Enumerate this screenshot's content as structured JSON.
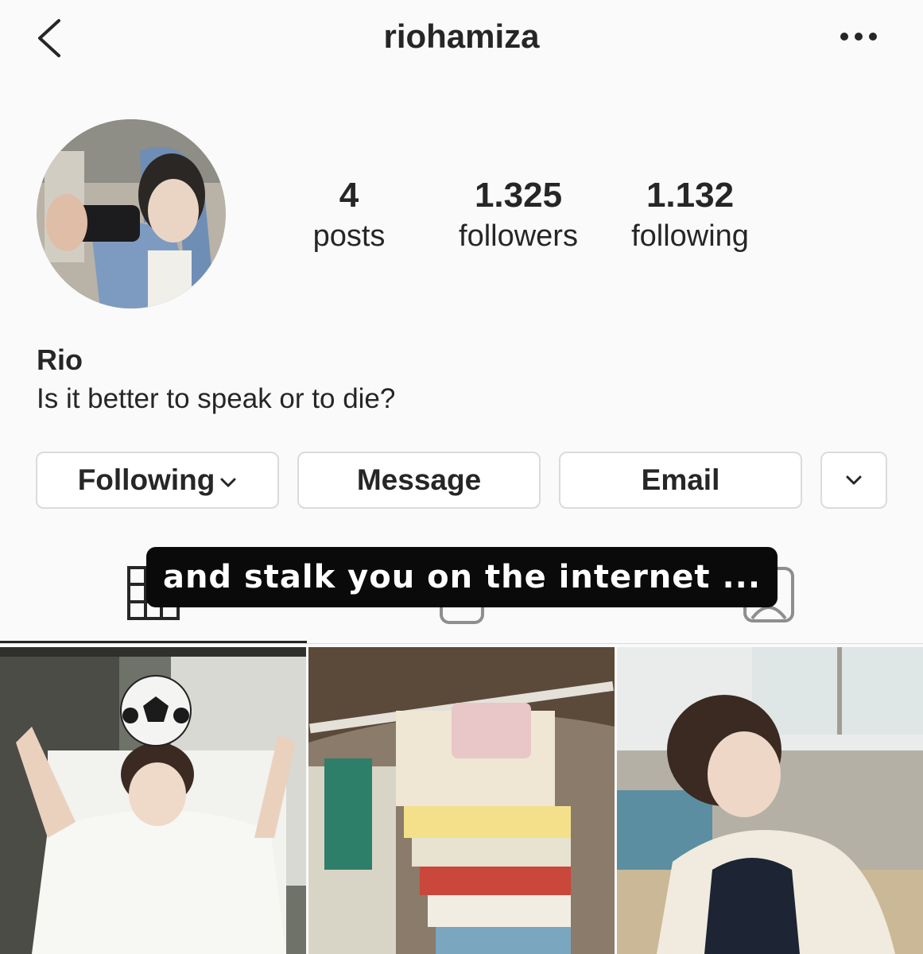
{
  "header": {
    "username": "riohamiza",
    "back_icon": "chevron-left-icon",
    "more_icon": "more-horizontal-icon"
  },
  "profile": {
    "avatar": "profile-photo",
    "stats": [
      {
        "value": "4",
        "label": "posts"
      },
      {
        "value": "1.325",
        "label": "followers"
      },
      {
        "value": "1.132",
        "label": "following"
      }
    ],
    "name": "Rio",
    "bio": "Is it better to speak or to die?"
  },
  "actions": {
    "following": "Following",
    "message": "Message",
    "email": "Email",
    "more_icon": "chevron-down-icon"
  },
  "tabs": {
    "grid_icon": "grid-icon",
    "reels_icon": "reels-icon",
    "tagged_icon": "tagged-icon"
  },
  "overlay": {
    "caption": "and stalk you on the internet ..."
  },
  "posts": [
    "post-1",
    "post-2",
    "post-3"
  ],
  "colors": {
    "text": "#262626",
    "border": "#dbdbdb",
    "background": "#fafafa"
  }
}
